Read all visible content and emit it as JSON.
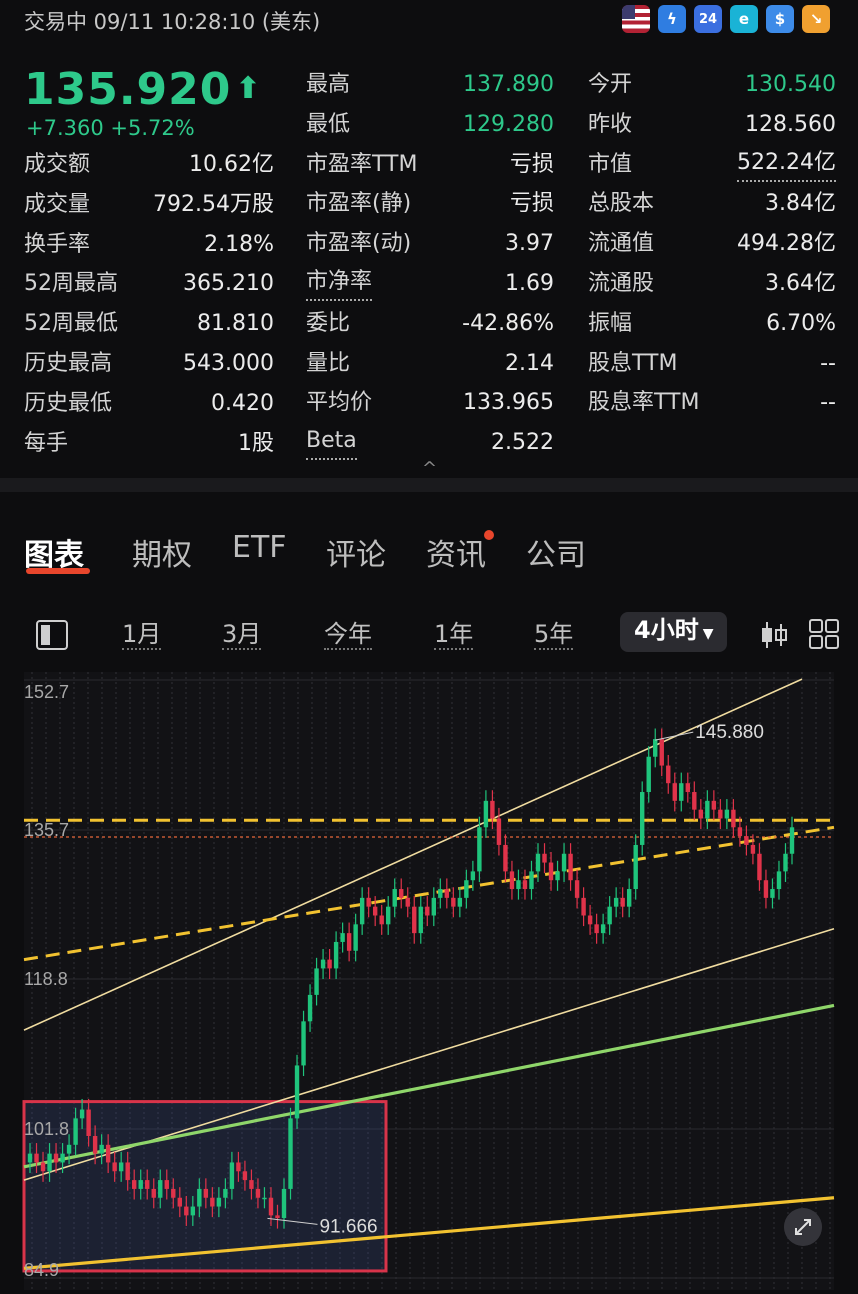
{
  "status": "交易中 09/11 10:28:10 (美东)",
  "badges": [
    "24"
  ],
  "quote": {
    "price": "135.920",
    "arrow": "⬆",
    "change": "+7.360  +5.72%"
  },
  "stats": {
    "col1": [
      {
        "label": "成交额",
        "value": "10.62亿"
      },
      {
        "label": "成交量",
        "value": "792.54万股"
      },
      {
        "label": "换手率",
        "value": "2.18%"
      },
      {
        "label": "52周最高",
        "value": "365.210"
      },
      {
        "label": "52周最低",
        "value": "81.810"
      },
      {
        "label": "历史最高",
        "value": "543.000"
      },
      {
        "label": "历史最低",
        "value": "0.420"
      },
      {
        "label": "每手",
        "value": "1股"
      }
    ],
    "col2": [
      {
        "label": "最高",
        "value": "137.890"
      },
      {
        "label": "最低",
        "value": "129.280"
      },
      {
        "label": "市盈率TTM",
        "value": "亏损"
      },
      {
        "label": "市盈率(静)",
        "value": "亏损"
      },
      {
        "label": "市盈率(动)",
        "value": "3.97"
      },
      {
        "label": "市净率",
        "value": "1.69"
      },
      {
        "label": "委比",
        "value": "-42.86%"
      },
      {
        "label": "量比",
        "value": "2.14"
      },
      {
        "label": "平均价",
        "value": "133.965"
      },
      {
        "label": "Beta",
        "value": "2.522"
      }
    ],
    "col3": [
      {
        "label": "今开",
        "value": "130.540"
      },
      {
        "label": "昨收",
        "value": "128.560"
      },
      {
        "label": "市值",
        "value": "522.24亿"
      },
      {
        "label": "总股本",
        "value": "3.84亿"
      },
      {
        "label": "流通值",
        "value": "494.28亿"
      },
      {
        "label": "流通股",
        "value": "3.64亿"
      },
      {
        "label": "振幅",
        "value": "6.70%"
      },
      {
        "label": "股息TTM",
        "value": "--"
      },
      {
        "label": "股息率TTM",
        "value": "--"
      }
    ]
  },
  "collapse_icon": "^",
  "tabs": [
    "图表",
    "期权",
    "ETF",
    "评论",
    "资讯",
    "公司"
  ],
  "ranges": [
    "1月",
    "3月",
    "今年",
    "1年",
    "5年"
  ],
  "selected_range": "4小时",
  "chart": {
    "y_labels": [
      "152.7",
      "135.7",
      "118.8",
      "101.8",
      "84.9"
    ],
    "high_label": "145.880",
    "low_label": "91.666",
    "colors": {
      "up": "#1fc47c",
      "down": "#e0334a",
      "trend_yellow": "#f2c230",
      "trend_green": "#8fd66a",
      "trend_thin": "#f0dca0",
      "box": "#d8344a"
    }
  },
  "chart_data": {
    "type": "candlestick",
    "ylim": [
      84.9,
      152.7
    ],
    "y_ticks": [
      152.7,
      135.7,
      118.8,
      101.8,
      84.9
    ],
    "annotations": [
      {
        "label": "145.880",
        "value": 145.88
      },
      {
        "label": "91.666",
        "value": 91.666
      }
    ],
    "close": [
      99,
      98,
      97,
      99,
      98,
      99,
      100,
      103,
      104,
      101,
      99,
      100,
      98,
      97,
      98,
      96,
      95,
      96,
      95,
      94,
      96,
      95,
      94,
      93,
      92,
      93,
      95,
      94,
      93,
      94,
      95,
      98,
      97,
      96,
      95,
      94,
      94,
      92,
      91.7,
      95,
      103,
      109,
      114,
      117,
      120,
      121,
      120,
      123,
      124,
      122,
      125,
      128,
      127,
      126,
      125,
      127,
      129,
      128,
      127,
      124,
      127,
      126,
      128,
      129,
      128,
      127,
      128,
      130,
      131,
      136,
      139,
      137,
      134,
      131,
      129,
      130,
      129,
      131,
      133,
      132,
      130,
      131,
      133,
      130,
      128,
      126,
      125,
      124,
      125,
      127,
      128,
      127,
      129,
      134,
      140,
      144,
      146,
      143,
      141,
      139,
      141,
      140,
      138,
      137,
      139,
      138,
      137,
      138,
      136,
      135,
      134,
      133,
      130,
      128,
      129,
      131,
      133,
      136
    ]
  }
}
